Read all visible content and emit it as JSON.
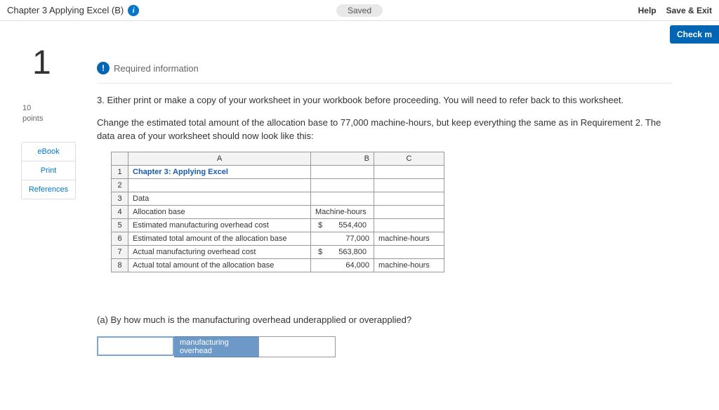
{
  "header": {
    "chapter_title": "Chapter 3 Applying Excel (B)",
    "info_icon": "i",
    "saved_label": "Saved",
    "help_label": "Help",
    "save_exit_label": "Save & Exit",
    "check_label": "Check m"
  },
  "sidebar": {
    "question_number": "1",
    "points_value": "10",
    "points_label": "points",
    "links": {
      "ebook": "eBook",
      "print": "Print",
      "references": "References"
    }
  },
  "main": {
    "required_info_label": "Required information",
    "required_icon": "!",
    "step3_text": "3. Either print or make a copy of your worksheet in your workbook before proceeding. You will need to refer back to this worksheet.",
    "instruction_text": "Change the estimated total amount of the allocation base to 77,000 machine-hours, but keep everything the same as in Requirement 2. The data area of your worksheet should now look like this:",
    "question_a": "(a) By how much is the manufacturing overhead underapplied or overapplied?",
    "answer_label": "manufacturing overhead"
  },
  "sheet": {
    "col_headers": {
      "A": "A",
      "B": "B",
      "C": "C"
    },
    "rows": [
      {
        "n": "1",
        "a": "Chapter 3: Applying Excel",
        "b": "",
        "c": "",
        "title": true
      },
      {
        "n": "2",
        "a": "",
        "b": "",
        "c": ""
      },
      {
        "n": "3",
        "a": "Data",
        "b": "",
        "c": ""
      },
      {
        "n": "4",
        "a": "Allocation base",
        "b": "Machine-hours",
        "c": "",
        "b_align": "left"
      },
      {
        "n": "5",
        "a": "Estimated manufacturing overhead cost",
        "b": "554,400",
        "c": "",
        "dollar": true
      },
      {
        "n": "6",
        "a": "Estimated total amount of the allocation base",
        "b": "77,000",
        "c": "machine-hours"
      },
      {
        "n": "7",
        "a": "Actual manufacturing overhead cost",
        "b": "563,800",
        "c": "",
        "dollar": true
      },
      {
        "n": "8",
        "a": "Actual total amount of the allocation base",
        "b": "64,000",
        "c": "machine-hours"
      }
    ]
  }
}
